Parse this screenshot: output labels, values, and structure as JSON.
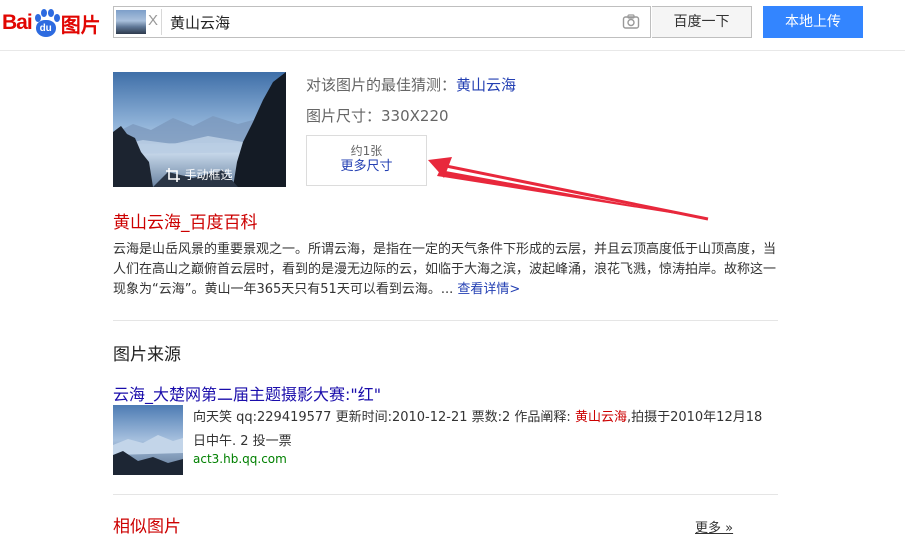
{
  "header": {
    "logo": {
      "bai": "Bai",
      "du": "du",
      "paw_text": "du",
      "pic": "图片"
    },
    "search": {
      "value": "黄山云海",
      "clear_symbol": "X"
    },
    "search_button": "百度一下",
    "upload_button": "本地上传"
  },
  "result": {
    "crop_label": "手动框选",
    "guess_prefix": "对该图片的最佳猜测：",
    "guess_value": "黄山云海",
    "size_label": "图片尺寸：330X220",
    "more_size": {
      "count": "约1张",
      "label": "更多尺寸"
    }
  },
  "baike": {
    "title": "黄山云海_百度百科",
    "description": "云海是山岳风景的重要景观之一。所谓云海，是指在一定的天气条件下形成的云层，并且云顶高度低于山顶高度，当人们在高山之巅俯首云层时，看到的是漫无边际的云，如临于大海之滨，波起峰涌，浪花飞溅，惊涛拍岸。故称这一现象为“云海”。黄山一年365天只有51天可以看到云海。...",
    "more": "查看详情>"
  },
  "source": {
    "section_title": "图片来源",
    "items": [
      {
        "title": "云海_大楚网第二届主题摄影大赛:\"红\"",
        "meta_prefix": "向天笑 qq:229419577 更新时间:2010-12-21 票数:2 作品阐释: ",
        "meta_highlight": "黄山云海",
        "meta_suffix": ",拍摄于2010年12月18日中午. 2 投一票",
        "url": "act3.hb.qq.com"
      }
    ]
  },
  "similar": {
    "title": "相似图片",
    "more": "更多 »"
  },
  "colors": {
    "brand_red": "#e10602",
    "brand_blue": "#2d6be0",
    "link": "#2440b3",
    "upload_button": "#3385ff",
    "annotation_arrow": "#e8283c"
  }
}
